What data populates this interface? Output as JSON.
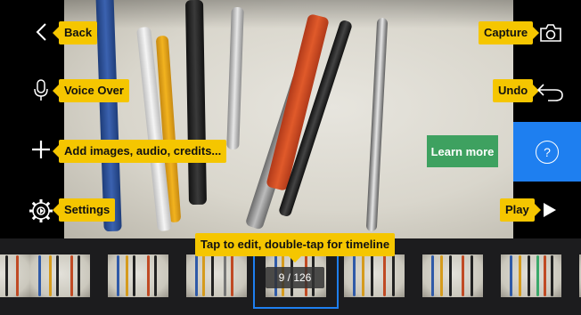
{
  "toolbar_left": {
    "back": "Back",
    "voice_over": "Voice Over",
    "add_media": "Add images, audio, credits...",
    "settings": "Settings"
  },
  "toolbar_right": {
    "capture": "Capture",
    "undo": "Undo",
    "learn_more": "Learn more",
    "help": "?",
    "play": "Play"
  },
  "timeline": {
    "hint": "Tap to edit, double-tap for timeline",
    "counter": "9 / 126"
  },
  "icons": [
    "back-chevron-icon",
    "microphone-icon",
    "plus-icon",
    "settings-gear-icon",
    "camera-icon",
    "undo-icon",
    "help-icon",
    "play-icon"
  ],
  "colors": {
    "tag": "#f5c600",
    "learn_more": "#3ea160",
    "accent": "#1e7ff0",
    "timeline_bg": "#1c1c1e"
  }
}
